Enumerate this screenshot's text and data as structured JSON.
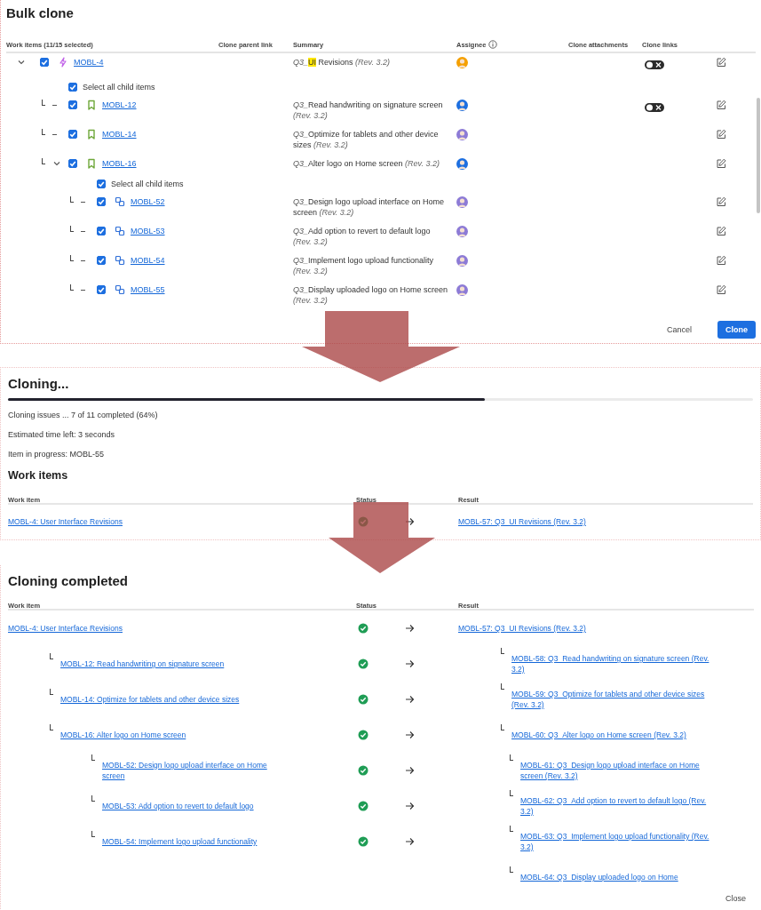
{
  "bulk_clone": {
    "title": "Bulk clone",
    "columns": [
      {
        "label": "Work items (11/15 selected)",
        "kind": "plain"
      },
      {
        "label": "Clone parent link",
        "kind": "plain"
      },
      {
        "label": "Summary",
        "kind": "plain"
      },
      {
        "label": "Assignee",
        "kind": "info"
      },
      {
        "label": "Clone attachments",
        "kind": "plain"
      },
      {
        "label": "Clone links",
        "kind": "plain"
      }
    ],
    "items": [
      {
        "kind": "epic",
        "key": "MOBL-4",
        "checked": true,
        "expanded": true,
        "summary": {
          "prefix": "Q3_",
          "highlight": "UI",
          "title": "Revisions",
          "revision": "(Rev. 3.2)"
        },
        "assignee": {
          "color": "#f5a000"
        },
        "clone_links": {
          "on": false
        },
        "select_all": {
          "label": "Select all child items",
          "checked": true
        },
        "children": [
          {
            "kind": "story",
            "key": "MOBL-12",
            "checked": true,
            "summary": {
              "prefix": "Q3_",
              "title": "Read handwriting on signature screen",
              "revision": "(Rev. 3.2)"
            },
            "assignee": {
              "color": "#1d6fe0"
            },
            "clone_links": {
              "on": false
            }
          },
          {
            "kind": "story",
            "key": "MOBL-14",
            "checked": true,
            "summary": {
              "prefix": "Q3_",
              "title": "Optimize for tablets and other device sizes",
              "revision": "(Rev. 3.2)"
            },
            "assignee": {
              "color": "#8d7bd6"
            }
          },
          {
            "kind": "story",
            "key": "MOBL-16",
            "checked": true,
            "expanded": true,
            "summary": {
              "prefix": "Q3_",
              "title": "Alter logo on Home screen",
              "revision": "(Rev. 3.2)"
            },
            "assignee": {
              "color": "#1d6fe0"
            },
            "select_all": {
              "label": "Select all child items",
              "checked": true
            },
            "children": [
              {
                "kind": "subtask",
                "key": "MOBL-52",
                "checked": true,
                "summary": {
                  "prefix": "Q3_",
                  "title": "Design logo upload interface on Home screen",
                  "revision": "(Rev. 3.2)"
                },
                "assignee": {
                  "color": "#8d7bd6"
                }
              },
              {
                "kind": "subtask",
                "key": "MOBL-53",
                "checked": true,
                "summary": {
                  "prefix": "Q3_",
                  "title": "Add option to revert to default logo",
                  "revision": "(Rev. 3.2)"
                },
                "assignee": {
                  "color": "#8d7bd6"
                }
              },
              {
                "kind": "subtask",
                "key": "MOBL-54",
                "checked": true,
                "summary": {
                  "prefix": "Q3_",
                  "title": "Implement logo upload functionality",
                  "revision": "(Rev. 3.2)"
                },
                "assignee": {
                  "color": "#8d7bd6"
                }
              },
              {
                "kind": "subtask",
                "key": "MOBL-55",
                "checked": true,
                "summary": {
                  "prefix": "Q3_",
                  "title": "Display uploaded logo on Home screen",
                  "revision": "(Rev. 3.2)"
                },
                "assignee": {
                  "color": "#8d7bd6"
                }
              }
            ]
          }
        ]
      }
    ],
    "buttons": [
      {
        "label": "Cancel",
        "kind": "subtle"
      },
      {
        "label": "Clone",
        "kind": "primary"
      }
    ]
  },
  "cloning": {
    "title": "Cloning...",
    "progress": {
      "level": 0.64
    },
    "lines": [
      "Cloning issues ... 7 of 11 completed (64%)",
      "Estimated time left: 3 seconds",
      "Item in progress: MOBL-55"
    ],
    "section_title": "Work items",
    "columns": [
      "Work item",
      "Status",
      "Result"
    ],
    "rows": [
      {
        "work_item": "MOBL-4: User Interface Revisions",
        "done": true,
        "result": "MOBL-57: Q3_UI Revisions (Rev. 3.2)"
      }
    ]
  },
  "completed": {
    "title": "Cloning completed",
    "columns": [
      "Work item",
      "Status",
      "Result"
    ],
    "rows": [
      {
        "work_item": "MOBL-4: User Interface Revisions",
        "done": true,
        "result": "MOBL-57: Q3_UI Revisions (Rev. 3.2)",
        "children": [
          {
            "work_item": "MOBL-12: Read handwriting on signature screen",
            "done": true,
            "result": "MOBL-58: Q3_Read handwriting on signature screen (Rev. 3.2)"
          },
          {
            "work_item": "MOBL-14: Optimize for tablets and other device sizes",
            "done": true,
            "result": "MOBL-59: Q3_Optimize for tablets and other device sizes (Rev. 3.2)"
          },
          {
            "work_item": "MOBL-16: Alter logo on Home screen",
            "done": true,
            "result": "MOBL-60: Q3_Alter logo on Home screen (Rev. 3.2)",
            "children": [
              {
                "work_item": "MOBL-52: Design logo upload interface on Home screen",
                "done": true,
                "result": "MOBL-61: Q3_Design logo upload interface on Home screen (Rev. 3.2)"
              },
              {
                "work_item": "MOBL-53: Add option to revert to default logo",
                "done": true,
                "result": "MOBL-62: Q3_Add option to revert to default logo (Rev. 3.2)"
              },
              {
                "work_item": "MOBL-54: Implement logo upload functionality",
                "done": true,
                "result": "MOBL-63: Q3_Implement logo upload functionality (Rev. 3.2)"
              },
              {
                "result": "MOBL-64: Q3_Display uploaded logo on Home"
              }
            ]
          }
        ]
      }
    ],
    "close": "Close"
  }
}
